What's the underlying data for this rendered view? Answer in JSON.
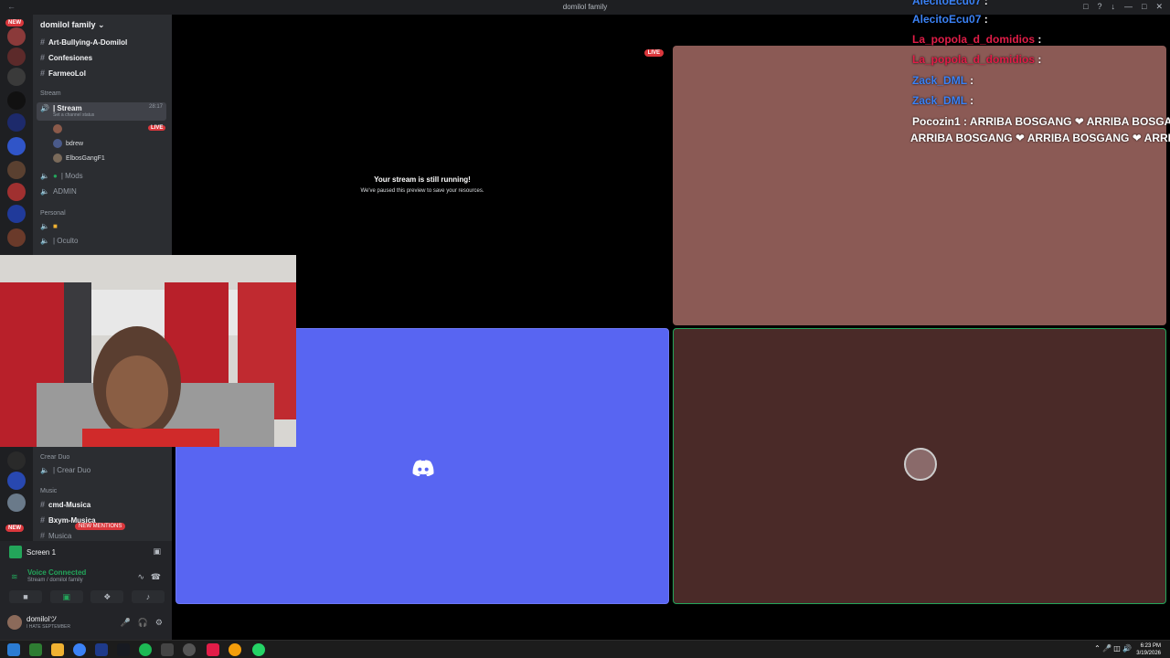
{
  "window": {
    "title": "domilol family"
  },
  "servers": {
    "new_badge": "NEW",
    "new_badge_bottom": "NEW"
  },
  "sidebar": {
    "guild_name": "domilol family",
    "text_channels": [
      "Art-Bullying-A-Domilol",
      "Confesiones",
      "FarmeoLol"
    ],
    "stream_category": "Stream",
    "stream_channel": "| Stream",
    "stream_time": "28:17",
    "stream_status": "Set a channel status",
    "users": [
      "bdrew",
      "ElbosGangF1"
    ],
    "live_label": "LIVE",
    "voice_channels": [
      "| Mods",
      "ADMIN"
    ],
    "personal_category": "Personal",
    "personal_channel": "| Oculto",
    "crear_category": "Crear Duo",
    "crear_channel": "| Crear Duo",
    "music_category": "Music",
    "music_channels": [
      "cmd-Musica",
      "Bxym-Musica",
      "Musica"
    ],
    "new_mentions": "NEW MENTIONS"
  },
  "panel": {
    "screen_label": "Screen 1",
    "voice_connected": "Voice Connected",
    "voice_sub": "Stream / domilol family",
    "username": "domilolツ",
    "user_status": "I HATE SEPTEMBER"
  },
  "stage": {
    "paused_title": "Your stream is still running!",
    "paused_sub": "We've paused this preview to save your resources.",
    "live_label": "LIVE"
  },
  "chat": [
    {
      "user": "AlecitoEcu07",
      "msg": " :",
      "color": "#3b82f6"
    },
    {
      "user": "AlecitoEcu07",
      "msg": " :",
      "color": "#3b82f6"
    },
    {
      "user": "La_popola_d_domidios",
      "msg": " :",
      "color": "#e11d48"
    },
    {
      "user": "La_popola_d_domidios",
      "msg": " :",
      "color": "#e11d48"
    },
    {
      "user": "Zack_DML",
      "msg": " :",
      "color": "#3b82f6"
    },
    {
      "user": "Zack_DML",
      "msg": " :",
      "color": "#3b82f6"
    },
    {
      "user": "Pocozin1",
      "msg": " : ARRIBA BOSGANG ❤ ARRIBA BOSGANG",
      "color": "#ffffff"
    },
    {
      "user": "",
      "msg": "ARRIBA BOSGANG ❤ ARRIBA BOSGANG ❤ ARRIBA",
      "color": "#ffffff"
    }
  ],
  "taskbar": {
    "time": "6:23 PM",
    "date": "3/19/2026"
  },
  "colors": {
    "blurple": "#5865f2",
    "green": "#23a55a",
    "red": "#da373c"
  }
}
